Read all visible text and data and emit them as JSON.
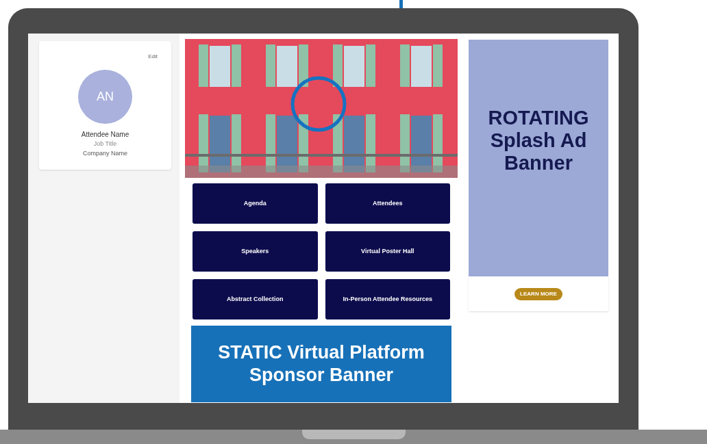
{
  "profile": {
    "initials": "AN",
    "edit": "Edit",
    "name": "Attendee Name",
    "job_title": "Job Title",
    "company": "Company Name"
  },
  "nav_buttons": [
    "Agenda",
    "Attendees",
    "Speakers",
    "Virtual Poster Hall",
    "Abstract Collection",
    "In-Person Attendee Resources"
  ],
  "sponsor_banner": {
    "lines": [
      "STATIC Virtual Platform",
      "Sponsor Banner"
    ]
  },
  "splash_ad": {
    "lines": [
      "ROTATING",
      "Splash Ad",
      "Banner"
    ],
    "button": "LEARN MORE"
  }
}
